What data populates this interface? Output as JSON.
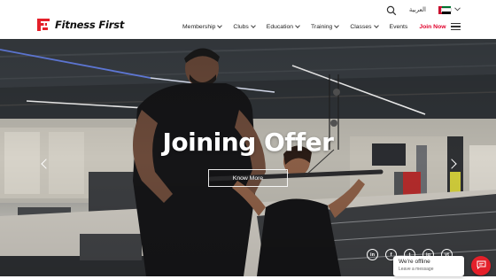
{
  "brand": {
    "name": "Fitness First",
    "accent": "#e4202a"
  },
  "utility": {
    "language": "العربية",
    "search_icon": "search-icon",
    "flag_icon": "uae-flag-icon"
  },
  "nav": {
    "items": [
      {
        "label": "Membership"
      },
      {
        "label": "Clubs"
      },
      {
        "label": "Education"
      },
      {
        "label": "Training"
      },
      {
        "label": "Classes"
      },
      {
        "label": "Events"
      }
    ],
    "join_label": "Join Now"
  },
  "hero": {
    "title": "Joining Offer",
    "button_label": "Know More"
  },
  "socials": {
    "linkedin": "in",
    "facebook": "f",
    "twitter": "t",
    "instagram": "ig",
    "youtube": "yt"
  },
  "chat": {
    "title": "We're offline",
    "subtitle": "Leave a message"
  }
}
